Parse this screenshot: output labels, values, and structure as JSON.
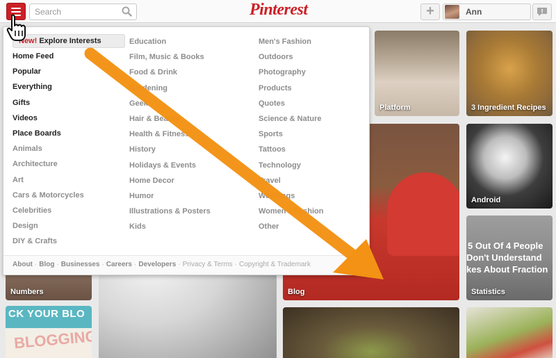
{
  "header": {
    "logo_text": "Pinterest",
    "search_placeholder": "Search",
    "add_label": "+",
    "user_name": "Ann"
  },
  "menu": {
    "explore_new": "New!",
    "explore_label": "Explore Interests",
    "col1": [
      "Home Feed",
      "Popular",
      "Everything",
      "Gifts",
      "Videos",
      "Place Boards",
      "Animals",
      "Architecture",
      "Art",
      "Cars & Motorcycles",
      "Celebrities",
      "Design",
      "DIY & Crafts"
    ],
    "col2": [
      "Education",
      "Film, Music & Books",
      "Food & Drink",
      "Gardening",
      "Geek",
      "Hair & Beauty",
      "Health & Fitness",
      "History",
      "Holidays & Events",
      "Home Decor",
      "Humor",
      "Illustrations & Posters",
      "Kids"
    ],
    "col3": [
      "Men's Fashion",
      "Outdoors",
      "Photography",
      "Products",
      "Quotes",
      "Science & Nature",
      "Sports",
      "Tattoos",
      "Technology",
      "Travel",
      "Weddings",
      "Women's Fashion",
      "Other"
    ]
  },
  "footer": {
    "links": [
      "About",
      "Blog",
      "Businesses",
      "Careers",
      "Developers",
      "Privacy & Terms",
      "Copyright & Trademark"
    ]
  },
  "pins": {
    "platform": "Platform",
    "recipes": "3 Ingredient Recipes",
    "android": "Android",
    "blog": "Blog",
    "numbers": "Numbers",
    "statistics": "Statistics",
    "stats_text_1": "5 Out Of 4 People",
    "stats_text_2": "Don't Understand",
    "stats_text_3": "kes About Fraction",
    "blogging_text": "BLOGGING",
    "blog_sign_text": "ck your blo"
  },
  "colors": {
    "brand": "#cb2027",
    "arrow": "#f39214"
  }
}
